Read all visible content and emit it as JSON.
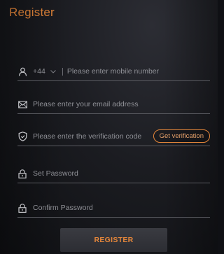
{
  "header": {
    "title": "Register"
  },
  "colors": {
    "accent": "#e6873a",
    "text_muted": "#8f9096",
    "underline": "#5a5b61"
  },
  "form": {
    "phone": {
      "icon": "user-icon",
      "country_code": "+44",
      "placeholder": "Please enter mobile number"
    },
    "email": {
      "icon": "mail-icon",
      "placeholder": "Please enter your email address"
    },
    "verification": {
      "icon": "shield-check-icon",
      "placeholder": "Please enter the verification code",
      "button_label": "Get verification"
    },
    "password": {
      "icon": "lock-icon",
      "placeholder": "Set Password"
    },
    "confirm_password": {
      "icon": "lock-icon",
      "placeholder": "Confirm Password"
    },
    "submit_label": "REGISTER"
  }
}
